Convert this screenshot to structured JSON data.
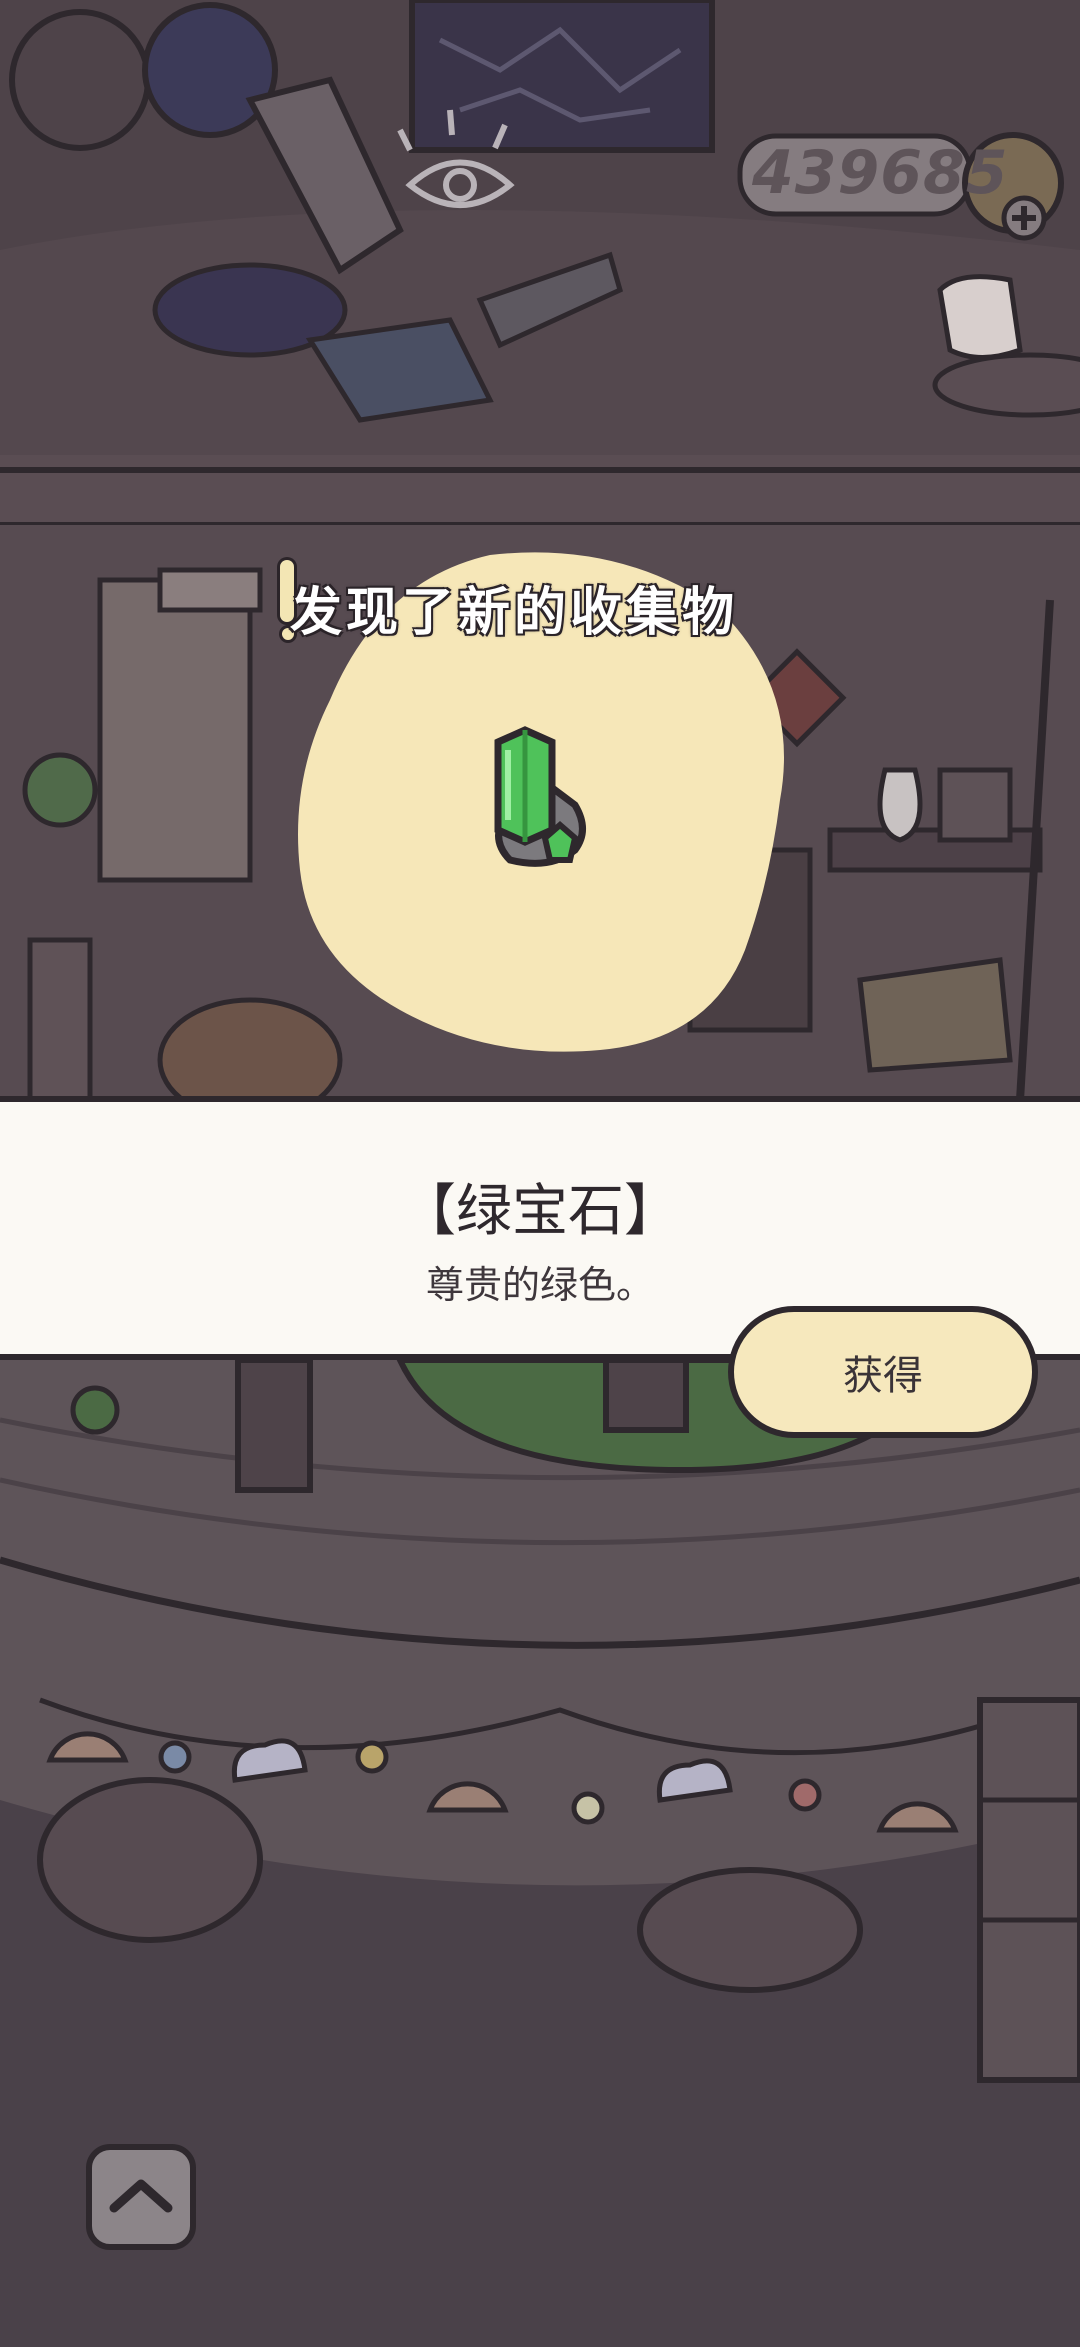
{
  "popup": {
    "title": "发现了新的收集物"
  },
  "item": {
    "name": "【绿宝石】",
    "description": "尊贵的绿色。",
    "icon": "green-gem-icon",
    "color": "#4fc25a"
  },
  "actions": {
    "obtain_label": "获得"
  },
  "hud": {
    "coin_count": "439685",
    "add_icon": "plus-icon"
  },
  "colors": {
    "panel": "#fbf9f4",
    "button": "#f6e8bd",
    "spotlight": "#f6e7b8",
    "dim_bg": "#4a4149"
  }
}
